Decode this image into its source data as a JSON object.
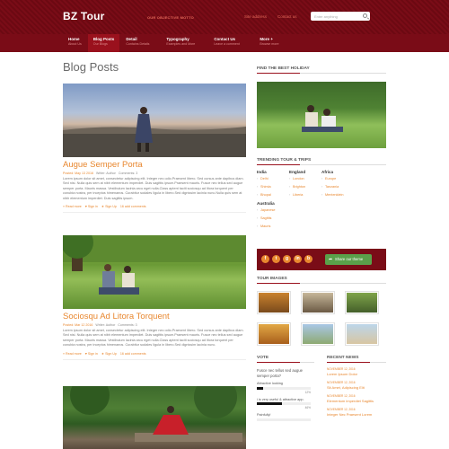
{
  "header": {
    "logo": "BZ Tour",
    "motto": "OUR OBJECTIVE MOTTO",
    "links": [
      "Site address",
      "Contact us"
    ],
    "search_placeholder": "Enter anything"
  },
  "nav": [
    {
      "label": "Home",
      "sub": "About Us"
    },
    {
      "label": "Blog Posts",
      "sub": "Our Blogs"
    },
    {
      "label": "Detail",
      "sub": "Contains Details"
    },
    {
      "label": "Typography",
      "sub": "Examples and More"
    },
    {
      "label": "Contact Us",
      "sub": "Leave a comment"
    },
    {
      "label": "More +",
      "sub": "Browse more"
    }
  ],
  "main": {
    "title": "Blog Posts",
    "posts": [
      {
        "title": "Augue Semper Porta",
        "meta_posted": "Posted: May 13 2016",
        "meta_author": "Writer: Author",
        "meta_comments": "Comments: 3",
        "excerpt": "Lorem ipsum dolor sit amet, consectetur adipiscing elit. Integer nec odio.Praesent libero. Sed cursus ante dapibus diam. Sed nisi. Nulla quis sem at nibh elementum imperdiet. Duis sagittis ipsum.Praesent mauris. Fusce nec tellus sed augue semper porta. Mauris massa. Vestibulum lacinia arcu eget nulla.Class aptent taciti sociosqu ad litora torquent per conubia nostra, per inceptos himenaeos. Curabitur sodales ligula in libero.Sed dignissim lacinia nunc.Nulla quis sem at nibh elementum imperdiet. Duis sagittis ipsum.",
        "actions": [
          "» Read more",
          "♥ Sign in",
          "★ Sign Up",
          "16 add comments"
        ]
      },
      {
        "title": "Sociosqu Ad Litora Torquent",
        "meta_posted": "Posted: Mar 12 2016",
        "meta_author": "Writer: Author",
        "meta_comments": "Comments: 3",
        "excerpt": "Lorem ipsum dolor sit amet, consectetur adipiscing elit. Integer nec odio.Praesent libero. Sed cursus ante dapibus diam. Sed nisi. Nulla quis sem at nibh elementum imperdiet. Duis sagittis ipsum.Praesent mauris. Fusce nec tellus sed augue semper porta. Mauris massa. Vestibulum lacinia arcu eget nulla.Class aptent taciti sociosqu ad litora torquent per conubia nostra, per inceptos himenaeos. Curabitur sodales ligula in libero.Sed dignissim lacinia nunc.",
        "actions": [
          "» Read more",
          "♥ Sign in",
          "★ Sign Up",
          "16 add comments"
        ]
      }
    ]
  },
  "sidebar": {
    "find_title": "FIND THE BEST HOLIDAY",
    "trending_title": "TRENDING TOUR & TRIPS",
    "trending": [
      {
        "country": "India",
        "items": [
          "Delhi",
          "Shimla",
          "Bhopal"
        ]
      },
      {
        "country": "England",
        "items": [
          "London",
          "Brighton",
          "Liberia"
        ]
      },
      {
        "country": "Africa",
        "items": [
          "Europe",
          "Tanzania",
          "Mentenklein"
        ]
      }
    ],
    "trending_extra": {
      "country": "Australia",
      "items": [
        "Japanese",
        "Sagittis",
        "Mauris"
      ]
    },
    "social": [
      "f",
      "t",
      "g",
      "in",
      "b"
    ],
    "share_label": "Share our theme",
    "tour_images_title": "TOUR IMAGES",
    "vote": {
      "title": "VOTE",
      "question": "Fusce nec tellus sed augue semper porta?",
      "options": [
        {
          "label": "Attractive looking",
          "pct": 12
        },
        {
          "label": "i is very useful & attractive app.",
          "pct": 46
        },
        {
          "label": "Painfully!",
          "pct": 0
        }
      ]
    },
    "news": {
      "title": "RECENT NEWS",
      "items": [
        {
          "date": "NOVEMBER 12, 2016",
          "title": "Lorem Ipsum Dolor"
        },
        {
          "date": "NOVEMBER 12, 2016",
          "title": "Sit Amet, Adipiscing Elit"
        },
        {
          "date": "NOVEMBER 12, 2016",
          "title": "Elementum imperdiet Sagittis"
        },
        {
          "date": "NOVEMBER 12, 2016",
          "title": "Integer Nec Praesent Lorem"
        }
      ]
    }
  }
}
